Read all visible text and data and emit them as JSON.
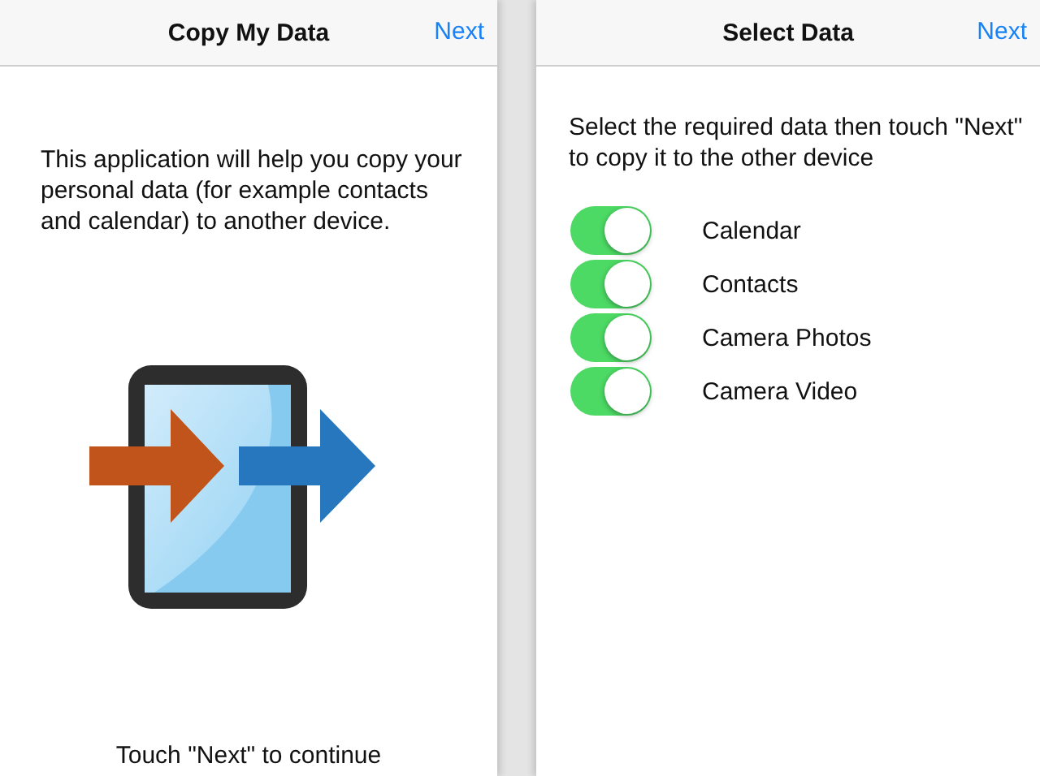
{
  "screens": [
    {
      "title": "Copy My Data",
      "action": "Next",
      "intro": "This application will help you copy your personal data (for example contacts and calendar) to another device.",
      "footer": "Touch \"Next\" to continue"
    },
    {
      "title": "Select Data",
      "action": "Next",
      "intro": "Select the required data then touch \"Next\" to copy it to the other device",
      "options": [
        {
          "label": "Calendar",
          "on": true
        },
        {
          "label": "Contacts",
          "on": true
        },
        {
          "label": "Camera Photos",
          "on": true
        },
        {
          "label": "Camera Video",
          "on": true
        }
      ]
    }
  ]
}
